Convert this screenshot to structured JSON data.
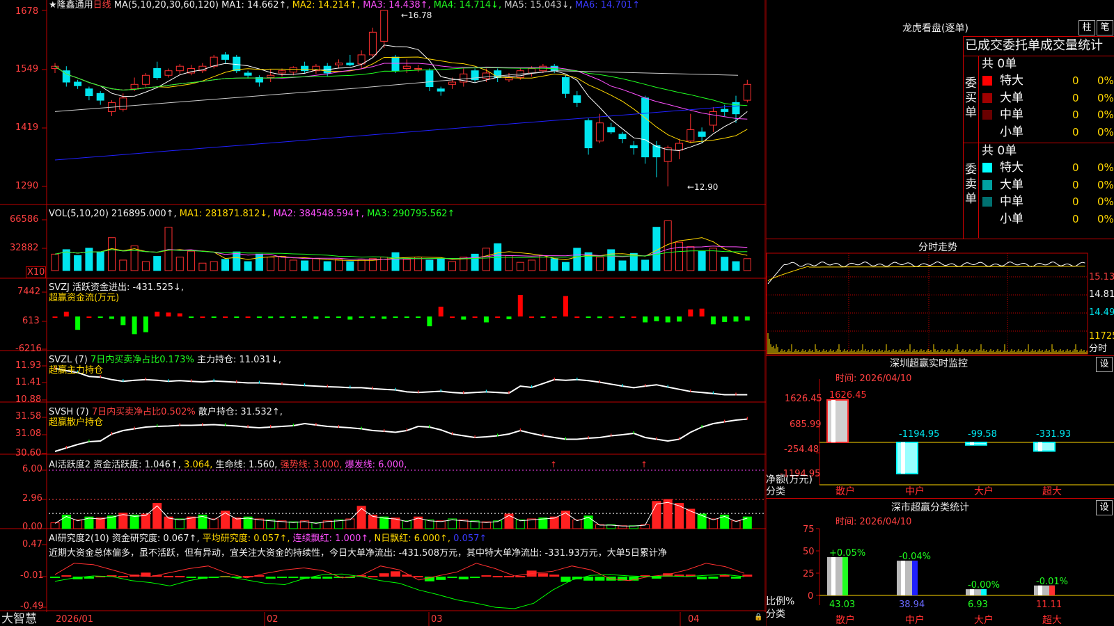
{
  "colors": {
    "up": "#ff3030",
    "down": "#00e5ee",
    "frame": "#c00000",
    "ma1": "#ffffff",
    "ma2": "#ffd700",
    "ma3": "#ff50ff",
    "ma4": "#20ff20",
    "ma5": "#cccccc",
    "ma6": "#2020ff"
  },
  "main": {
    "star": "★",
    "stock_name": "隆鑫通用",
    "period": "日线",
    "ma_params": "MA(5,10,20,30,60,120)",
    "ma1": "MA1: 14.662↑,",
    "ma2": "MA2: 14.214↑,",
    "ma3": "MA3: 14.438↑,",
    "ma4": "MA4: 14.714↓,",
    "ma5": "MA5: 15.043↓,",
    "ma6": "MA6: 14.701↑",
    "axis": [
      "1678",
      "1549",
      "1419",
      "1290"
    ],
    "high_label": "←16.78",
    "low_label": "←12.90"
  },
  "vol": {
    "params": "VOL(5,10,20)",
    "value": "216895.000↑,",
    "ma1": "MA1: 281871.812↓,",
    "ma2": "MA2: 384548.594↑,",
    "ma3": "MA3: 290795.562↑",
    "axis": [
      "66586",
      "32882"
    ],
    "unit": "X10"
  },
  "svzj": {
    "name": "SVZJ",
    "label": "活跃资金进出: -431.525↓,",
    "sub": "超赢资金流(万元)",
    "axis": [
      "7442",
      "613",
      "-6216"
    ]
  },
  "svzl": {
    "name": "SVZL (7)",
    "ratio": "7日内买卖净占比0.173%",
    "hold": "主力持仓: 11.031↓,",
    "sub": "超赢主力持仓",
    "axis": [
      "11.93",
      "11.41",
      "10.88"
    ]
  },
  "svsh": {
    "name": "SVSH (7)",
    "ratio": "7日内买卖净占比0.502%",
    "hold": "散户持仓: 31.532↑,",
    "sub": "超赢散户持仓",
    "axis": [
      "31.58",
      "31.08",
      "30.60"
    ]
  },
  "ai1": {
    "name": "AI活跃度2",
    "a": "资金活跃度: 1.046↑,",
    "b": "3.064,",
    "c": "生命线: 1.560,",
    "d": "强势线: 3.000,",
    "e": "爆发线: 6.000,",
    "axis": [
      "6.00",
      "2.96",
      "0.00"
    ]
  },
  "ai2": {
    "name": "AI研究度2(10)",
    "a": "资金研究度: 0.067↑,",
    "b": "平均研究度: 0.057↑,",
    "c": "连续飘红: 1.000↑,",
    "d": "N日飘红: 6.000↑,",
    "e": "0.057↑",
    "comment": "近期大资金总体偏多，虽不活跃，但有异动，宜关注大资金的持续性，今日大单净流出: -431.508万元，其中特大单净流出: -331.93万元，大单5日累计净",
    "axis": [
      "0.47",
      "-0.01",
      "-0.49"
    ]
  },
  "xaxis": {
    "labels": [
      "2026/01",
      "02",
      "03",
      "04"
    ],
    "footer": "大智慧"
  },
  "right": {
    "title": "龙虎看盘(逐单)",
    "btn1": "柱",
    "btn2": "笔",
    "stat_title": "已成交委托单成交量统计",
    "buy": {
      "side_label": "委买单",
      "total": "共 0单",
      "rows": [
        {
          "name": "特大",
          "count": "0",
          "pct": "0%",
          "color": "#ff0000"
        },
        {
          "name": "大单",
          "count": "0",
          "pct": "0%",
          "color": "#a00000"
        },
        {
          "name": "中单",
          "count": "0",
          "pct": "0%",
          "color": "#6a0000"
        },
        {
          "name": "小单",
          "count": "0",
          "pct": "0%",
          "color": ""
        }
      ]
    },
    "sell": {
      "side_label": "委卖单",
      "total": "共 0单",
      "rows": [
        {
          "name": "特大",
          "count": "0",
          "pct": "0%",
          "color": "#00ffff"
        },
        {
          "name": "大单",
          "count": "0",
          "pct": "0%",
          "color": "#00a0a0"
        },
        {
          "name": "中单",
          "count": "0",
          "pct": "0%",
          "color": "#007070"
        },
        {
          "name": "小单",
          "count": "0",
          "pct": "0%",
          "color": ""
        }
      ]
    },
    "intraday_title": "分时走势",
    "intraday_axis": [
      "15.13",
      "14.81",
      "14.49",
      "11725",
      "分时"
    ],
    "sz_monitor": {
      "title": "深圳超赢实时监控",
      "set": "设",
      "time": "时间: 2026/04/10",
      "axis": [
        "1626.45",
        "685.99",
        "-254.48",
        "-1194.95"
      ],
      "unit": "净额(万元)",
      "cat_label": "分类",
      "categories": [
        "散户",
        "中户",
        "大户",
        "超大"
      ],
      "values": [
        1626.45,
        -1194.95,
        -99.58,
        -331.93
      ],
      "value_labels": [
        "1626.45",
        "-1194.95",
        "-99.58",
        "-331.93"
      ]
    },
    "sz_class": {
      "title": "深市超赢分类统计",
      "set": "设",
      "time": "时间: 2026/04/10",
      "axis": [
        "75",
        "50",
        "25",
        "0"
      ],
      "unit": "比例%",
      "cat_label": "分类",
      "categories": [
        "散户",
        "中户",
        "大户",
        "超大"
      ],
      "ratios": [
        43.03,
        38.94,
        6.93,
        11.11
      ],
      "ratio_labels": [
        "43.03",
        "38.94",
        "6.93",
        "11.11"
      ],
      "change_labels": [
        "+0.05%",
        "-0.04%",
        "-0.00%",
        "-0.01%"
      ]
    }
  }
}
